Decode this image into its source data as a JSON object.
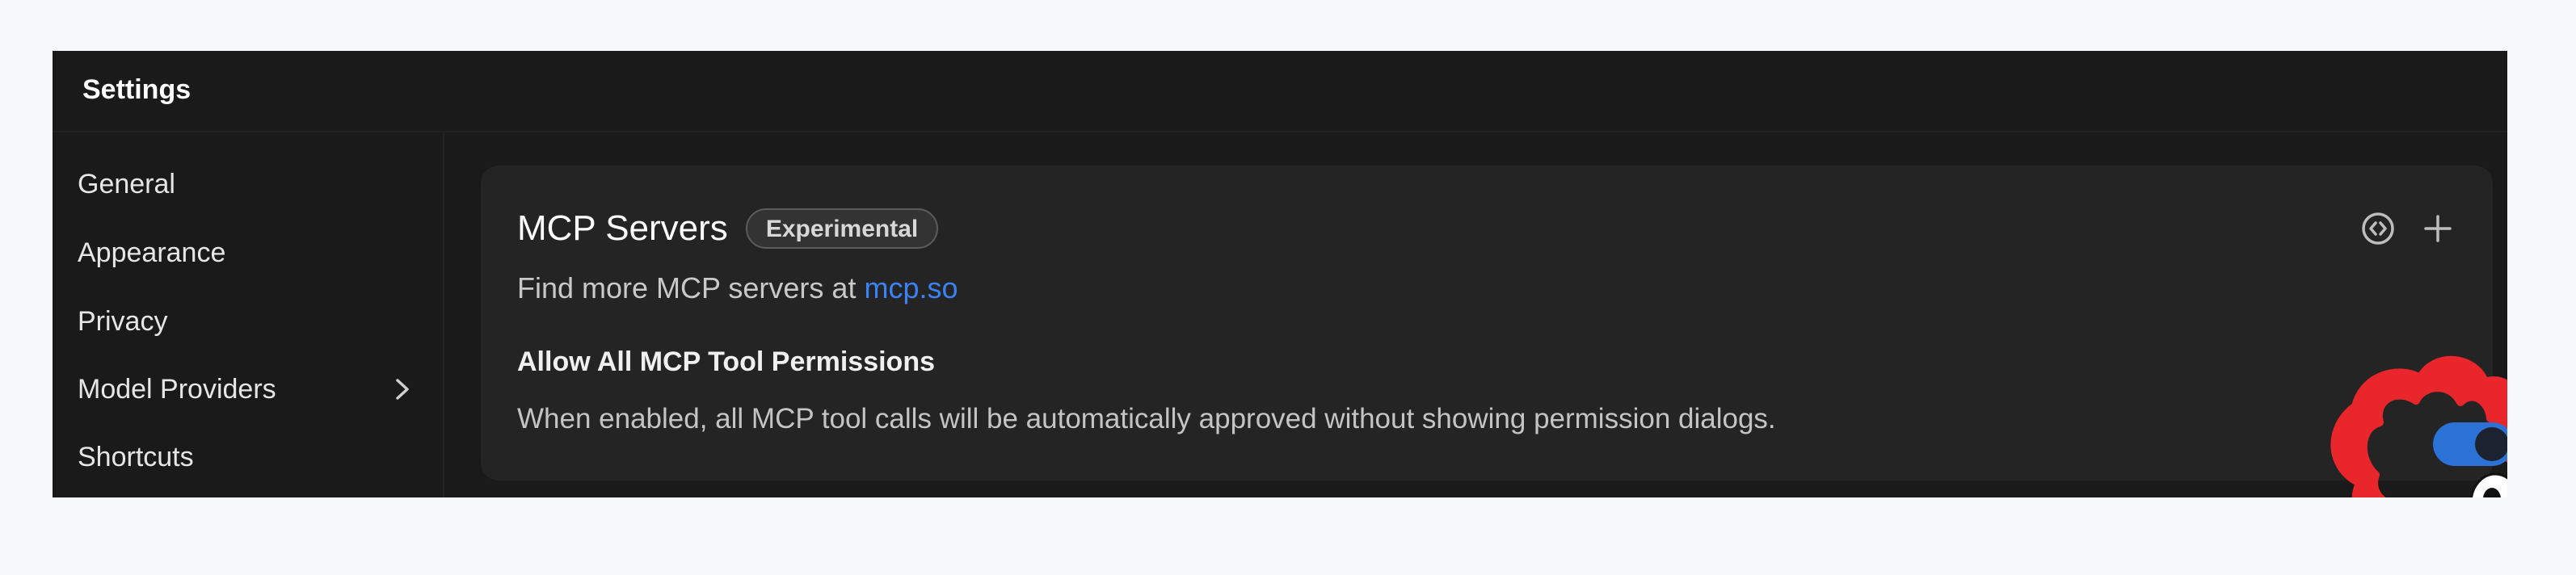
{
  "window": {
    "title": "Settings"
  },
  "sidebar": {
    "items": [
      {
        "label": "General",
        "icon": ""
      },
      {
        "label": "Appearance",
        "icon": ""
      },
      {
        "label": "Privacy",
        "icon": ""
      },
      {
        "label": "Model Providers",
        "icon": "chevron-right-icon"
      },
      {
        "label": "Shortcuts",
        "icon": ""
      }
    ]
  },
  "mcp": {
    "title": "MCP Servers",
    "badge": "Experimental",
    "find_more_prefix": "Find more MCP servers at ",
    "link_text": "mcp.so",
    "actions": [
      "code-icon",
      "plus-icon"
    ],
    "permission": {
      "title": "Allow All MCP Tool Permissions",
      "description": "When enabled, all MCP tool calls will be automatically approved without showing permission dialogs.",
      "enabled": true
    }
  },
  "colors": {
    "accent": "#3b82f6",
    "toggle_on": "#2c72d6",
    "annotation": "#e8262b",
    "background": "#1a1a1a",
    "card": "#242424"
  }
}
